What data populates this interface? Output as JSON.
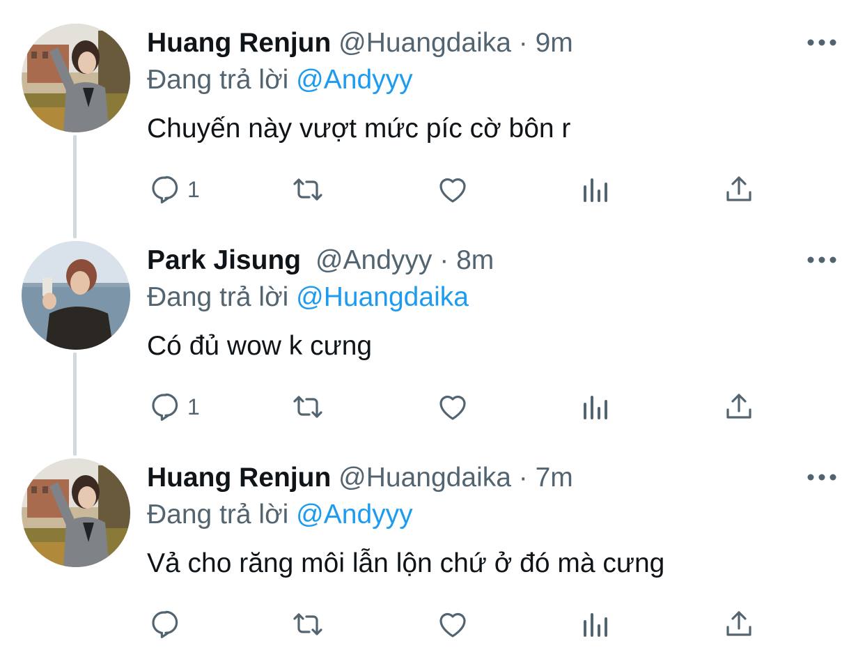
{
  "tweets": [
    {
      "name": "Huang Renjun",
      "handle": "@Huangdaika",
      "separator": "·",
      "time": "9m",
      "replying_prefix": "Đang trả lời",
      "replying_to": "@Andyyy",
      "text": "Chuyến này vượt mức píc cờ bôn r",
      "reply_count": "1"
    },
    {
      "name": "Park Jisung",
      "handle": "@Andyyy",
      "separator": "·",
      "time": "8m",
      "replying_prefix": "Đang trả lời",
      "replying_to": "@Huangdaika",
      "text": "Có đủ wow k cưng",
      "reply_count": "1"
    },
    {
      "name": "Huang Renjun",
      "handle": "@Huangdaika",
      "separator": "·",
      "time": "7m",
      "replying_prefix": "Đang trả lời",
      "replying_to": "@Andyyy",
      "text": "Vả cho răng môi lẫn lộn chứ ở đó mà cưng",
      "reply_count": ""
    }
  ],
  "icons": {
    "reply": "reply-icon",
    "retweet": "retweet-icon",
    "like": "heart-icon",
    "analytics": "analytics-icon",
    "share": "share-icon",
    "more": "more-icon"
  },
  "colors": {
    "name": "#0f1419",
    "secondary": "#536471",
    "mention": "#1d9bf0",
    "thread_line": "#cfd9de"
  }
}
